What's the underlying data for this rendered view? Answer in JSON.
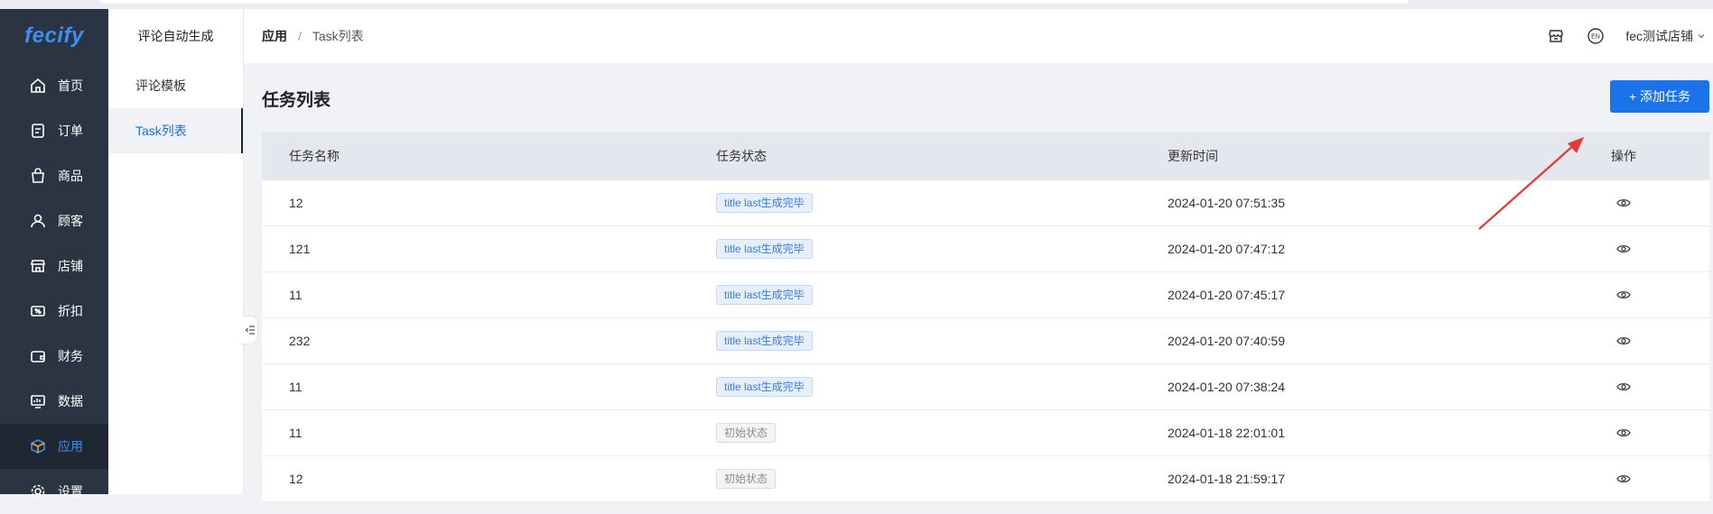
{
  "brand": {
    "logo_text": "fecify"
  },
  "sidebar": {
    "items": [
      {
        "label": "首页",
        "icon": "home-icon"
      },
      {
        "label": "订单",
        "icon": "order-icon"
      },
      {
        "label": "商品",
        "icon": "bag-icon"
      },
      {
        "label": "顾客",
        "icon": "user-icon"
      },
      {
        "label": "店铺",
        "icon": "store-icon"
      },
      {
        "label": "折扣",
        "icon": "discount-icon"
      },
      {
        "label": "财务",
        "icon": "wallet-icon"
      },
      {
        "label": "数据",
        "icon": "chart-icon"
      },
      {
        "label": "应用",
        "icon": "cube-icon",
        "active": true
      },
      {
        "label": "设置",
        "icon": "gear-icon"
      }
    ]
  },
  "subnav": {
    "title": "评论自动生成",
    "items": [
      {
        "label": "评论模板"
      },
      {
        "label": "Task列表",
        "active": true
      }
    ]
  },
  "header": {
    "breadcrumb": [
      "应用",
      "Task列表"
    ],
    "lang_icon": "EN",
    "store_name": "fec测试店铺"
  },
  "page": {
    "title": "任务列表",
    "add_button": "+ 添加任务"
  },
  "table": {
    "columns": [
      "任务名称",
      "任务状态",
      "更新时间",
      "操作"
    ],
    "rows": [
      {
        "name": "12",
        "status": "title last生成完毕",
        "status_type": "done",
        "updated": "2024-01-20 07:51:35"
      },
      {
        "name": "121",
        "status": "title last生成完毕",
        "status_type": "done",
        "updated": "2024-01-20 07:47:12"
      },
      {
        "name": "11",
        "status": "title last生成完毕",
        "status_type": "done",
        "updated": "2024-01-20 07:45:17"
      },
      {
        "name": "232",
        "status": "title last生成完毕",
        "status_type": "done",
        "updated": "2024-01-20 07:40:59"
      },
      {
        "name": "11",
        "status": "title last生成完毕",
        "status_type": "done",
        "updated": "2024-01-20 07:38:24"
      },
      {
        "name": "11",
        "status": "初始状态",
        "status_type": "init",
        "updated": "2024-01-18 22:01:01"
      },
      {
        "name": "12",
        "status": "初始状态",
        "status_type": "init",
        "updated": "2024-01-18 21:59:17"
      }
    ]
  },
  "colors": {
    "sidebar_bg": "#2a3442",
    "accent": "#1a73e8",
    "annotation_arrow": "#e53935"
  }
}
